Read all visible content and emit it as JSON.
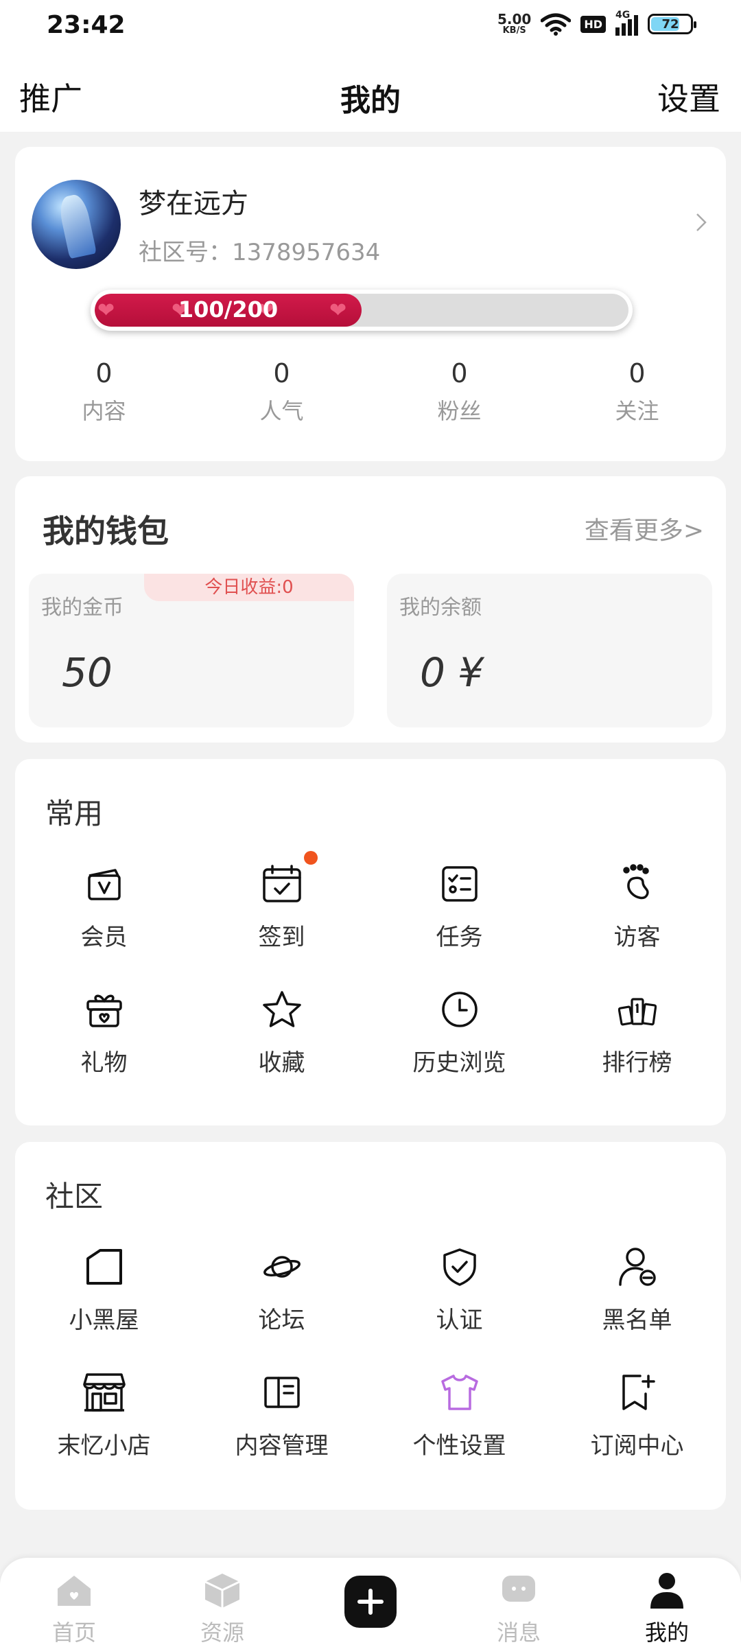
{
  "status_bar": {
    "time": "23:42",
    "speed_value": "5.00",
    "speed_unit": "KB/S",
    "hd": "HD",
    "network": "4G",
    "battery": "72"
  },
  "header": {
    "left": "推广",
    "title": "我的",
    "right": "设置"
  },
  "profile": {
    "nickname": "梦在远方",
    "community_id": "社区号：1378957634",
    "level_text": "100/200",
    "level_progress": 0.5,
    "stats": [
      {
        "value": "0",
        "label": "内容"
      },
      {
        "value": "0",
        "label": "人气"
      },
      {
        "value": "0",
        "label": "粉丝"
      },
      {
        "value": "0",
        "label": "关注"
      }
    ]
  },
  "wallet": {
    "title": "我的钱包",
    "more": "查看更多>",
    "coins_label": "我的金币",
    "today_earnings": "今日收益:0",
    "coins_value": "50",
    "balance_label": "我的余额",
    "balance_value": "0 ¥"
  },
  "common": {
    "title": "常用",
    "items": [
      {
        "label": "会员",
        "icon": "vip-bag-icon"
      },
      {
        "label": "签到",
        "icon": "calendar-check-icon"
      },
      {
        "label": "任务",
        "icon": "checklist-icon"
      },
      {
        "label": "访客",
        "icon": "footprint-icon"
      },
      {
        "label": "礼物",
        "icon": "gift-icon"
      },
      {
        "label": "收藏",
        "icon": "star-icon"
      },
      {
        "label": "历史浏览",
        "icon": "clock-icon"
      },
      {
        "label": "排行榜",
        "icon": "ranking-icon"
      }
    ]
  },
  "community": {
    "title": "社区",
    "items": [
      {
        "label": "小黑屋",
        "icon": "house-icon"
      },
      {
        "label": "论坛",
        "icon": "planet-icon"
      },
      {
        "label": "认证",
        "icon": "shield-check-icon"
      },
      {
        "label": "黑名单",
        "icon": "user-block-icon"
      },
      {
        "label": "末忆小店",
        "icon": "store-icon"
      },
      {
        "label": "内容管理",
        "icon": "book-icon"
      },
      {
        "label": "个性设置",
        "icon": "shirt-icon"
      },
      {
        "label": "订阅中心",
        "icon": "bookmark-plus-icon"
      }
    ]
  },
  "tabbar": {
    "items": [
      {
        "label": "首页",
        "icon": "home-icon"
      },
      {
        "label": "资源",
        "icon": "box-icon"
      },
      {
        "label": "",
        "icon": "add-icon"
      },
      {
        "label": "消息",
        "icon": "chat-icon"
      },
      {
        "label": "我的",
        "icon": "person-icon"
      }
    ],
    "active_index": 4
  },
  "colors": {
    "level_fill": "#c8143f",
    "notification_dot": "#f0541e",
    "today_earnings_text": "#e05050",
    "shirt_icon": "#b86be0"
  }
}
